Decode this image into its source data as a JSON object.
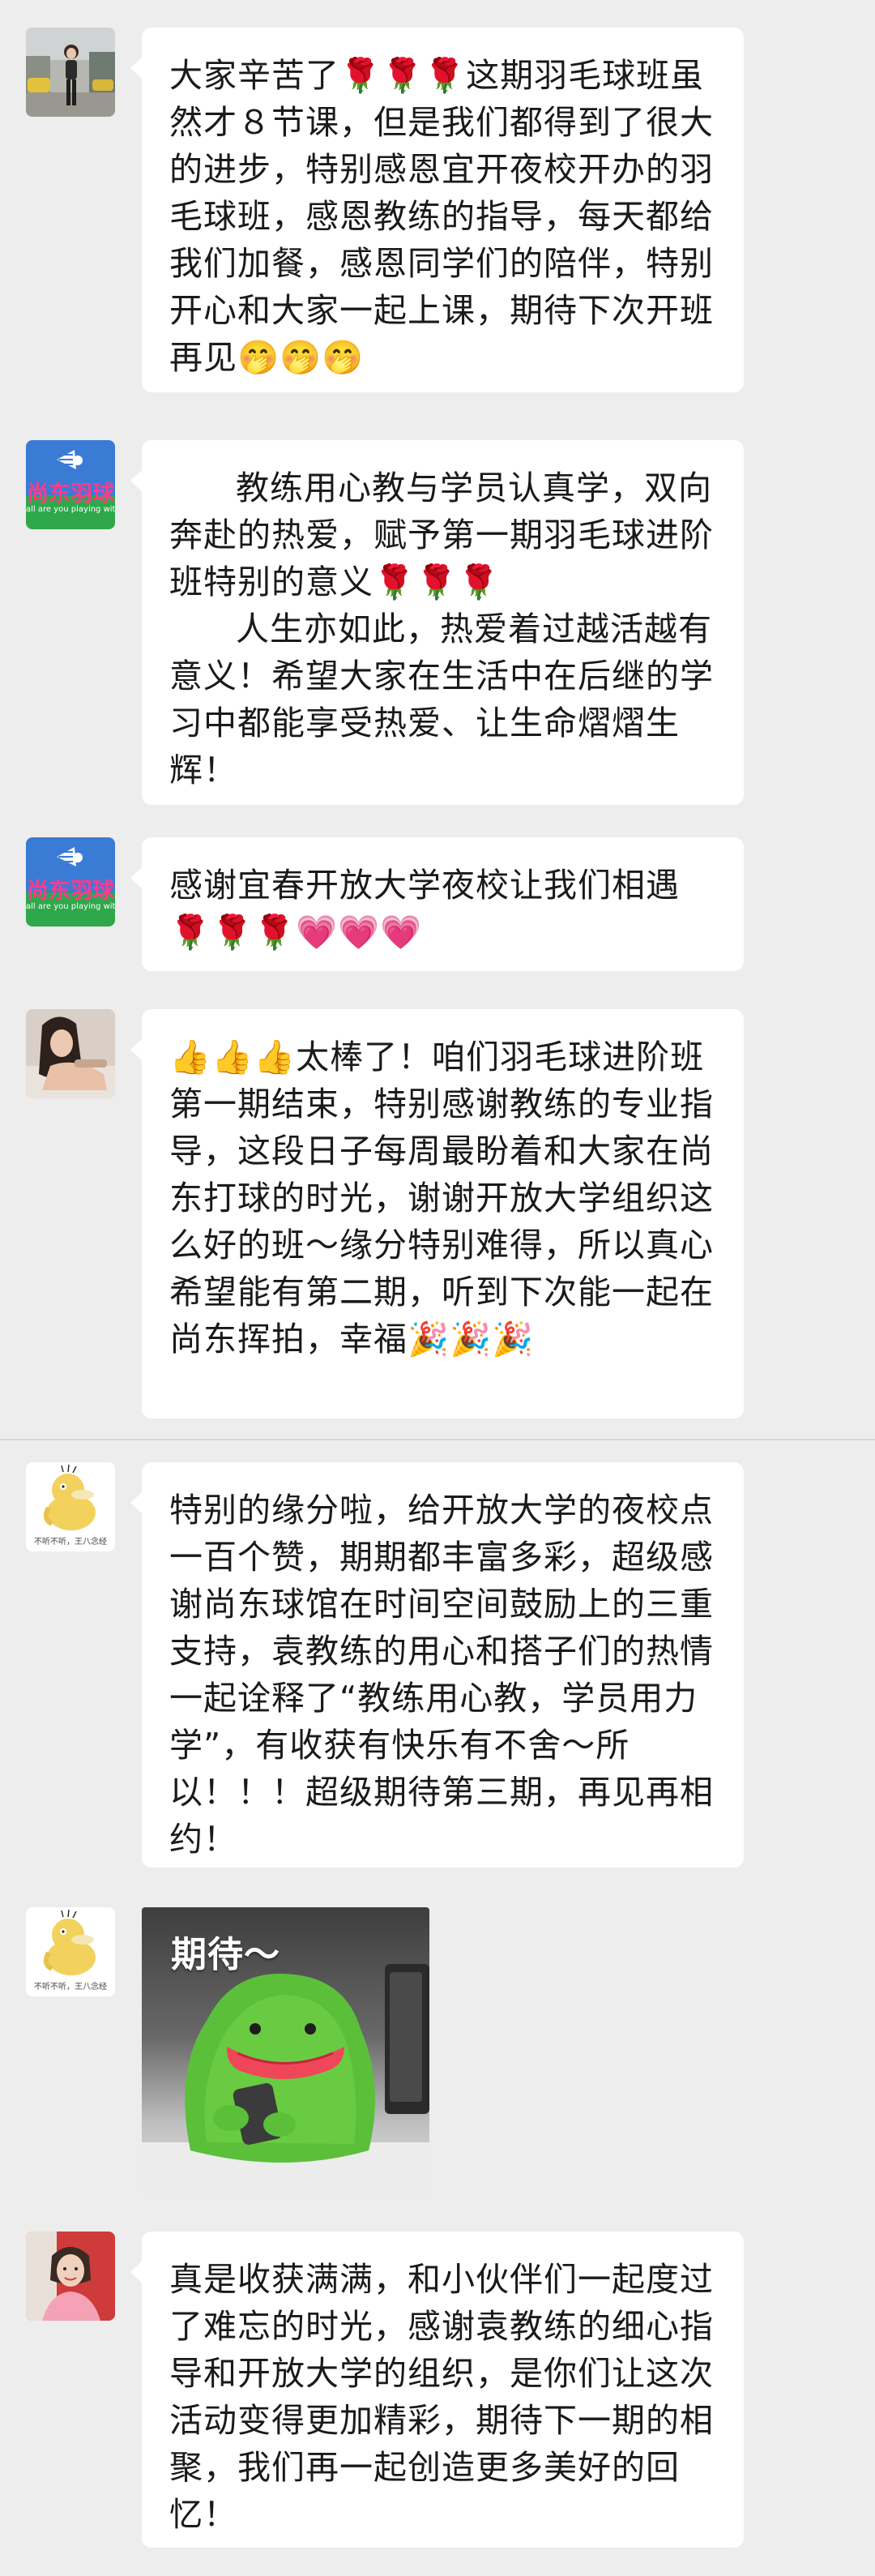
{
  "messages": [
    {
      "paragraphs": [
        "大家辛苦了🌹🌹🌹这期羽毛球班虽然才８节课，但是我们都得到了很大的进步，特别感恩宜开夜校开办的羽毛球班，感恩教练的指导，每天都给我们加餐，感恩同学们的陪伴，特别开心和大家一起上课，期待下次开班再见🤭🤭🤭"
      ]
    },
    {
      "avatar_title": "尚东羽球",
      "avatar_subtitle": "all are you playing with",
      "paragraphs": [
        "教练用心教与学员认真学，双向奔赴的热爱，赋予第一期羽毛球进阶班特别的意义🌹🌹🌹",
        "人生亦如此，热爱着过越活越有意义！希望大家在生活中在后继的学习中都能享受热爱、让生命熠熠生辉！"
      ]
    },
    {
      "avatar_title": "尚东羽球",
      "avatar_subtitle": "all are you playing with",
      "paragraphs": [
        "感谢宜春开放大学夜校让我们相遇🌹🌹🌹💗💗💗"
      ]
    },
    {
      "paragraphs": [
        "👍👍👍太棒了！咱们羽毛球进阶班第一期结束，特别感谢教练的专业指导，这段日子每周最盼着和大家在尚东打球的时光，谢谢开放大学组织这么好的班～缘分特别难得，所以真心希望能有第二期，听到下次能一起在尚东挥拍，幸福🎉🎉🎉"
      ]
    },
    {
      "avatar_label": "不听不听，王八念经",
      "paragraphs": [
        "特别的缘分啦，给开放大学的夜校点一百个赞，期期都丰富多彩，超级感谢尚东球馆在时间空间鼓励上的三重支持，袁教练的用心和搭子们的热情一起诠释了“教练用心教，学员用力学”，有收获有快乐有不舍～所以！！！超级期待第三期，再见再相约！"
      ]
    },
    {
      "avatar_label": "不听不听，王八念经",
      "sticker_caption": "期待～"
    },
    {
      "paragraphs": [
        "真是收获满满，和小伙伴们一起度过了难忘的时光，感谢袁教练的细心指导和开放大学的组织，是你们让这次活动变得更加精彩，期待下一期的相聚，我们再一起创造更多美好的回忆！"
      ]
    }
  ],
  "colors": {
    "background": "#ededed",
    "bubble": "#ffffff",
    "text": "#1a1a1a"
  }
}
